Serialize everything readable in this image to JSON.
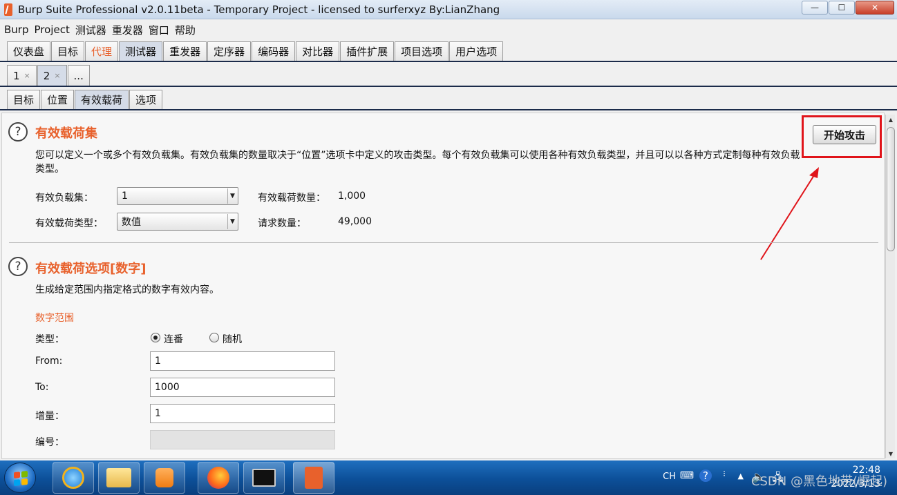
{
  "window": {
    "title": "Burp Suite Professional v2.0.11beta - Temporary Project - licensed to surferxyz By:LianZhang",
    "min": "—",
    "max": "☐",
    "close": "✕"
  },
  "menu": [
    "Burp",
    "Project",
    "测试器",
    "重发器",
    "窗口",
    "帮助"
  ],
  "main_tabs": [
    "仪表盘",
    "目标",
    "代理",
    "测试器",
    "重发器",
    "定序器",
    "编码器",
    "对比器",
    "插件扩展",
    "项目选项",
    "用户选项"
  ],
  "attack_tabs": [
    {
      "label": "1",
      "close": "×"
    },
    {
      "label": "2",
      "close": "×"
    },
    {
      "label": "..."
    }
  ],
  "sub_tabs": [
    "目标",
    "位置",
    "有效载荷",
    "选项"
  ],
  "payload_sets": {
    "help": "?",
    "title": "有效载荷集",
    "description": "您可以定义一个或多个有效负载集。有效负载集的数量取决于“位置”选项卡中定义的攻击类型。每个有效负载集可以使用各种有效负载类型，并且可以以各种方式定制每种有效负载类型。",
    "set_label": "有效负载集：",
    "set_value": "1",
    "type_label": "有效载荷类型：",
    "type_value": "数值",
    "count_label": "有效载荷数量：",
    "count_value": "1,000",
    "requests_label": "请求数量：",
    "requests_value": "49,000",
    "start_attack": "开始攻击"
  },
  "payload_options": {
    "help": "?",
    "title": "有效载荷选项[数字]",
    "description": "生成给定范围内指定格式的数字有效内容。",
    "range_heading": "数字范围",
    "type_label": "类型：",
    "radio_sequential": "连番",
    "radio_random": "随机",
    "from_label": "From:",
    "from_value": "1",
    "to_label": "To:",
    "to_value": "1000",
    "step_label": "增量：",
    "step_value": "1",
    "howmany_label": "编号：",
    "howmany_value": ""
  },
  "taskbar": {
    "tray_lang": "CH",
    "time": "22:48",
    "date": "2022/3/13",
    "watermark": "CSDN @黑色地带(崛起)"
  },
  "colors": {
    "accent_orange": "#e8612c",
    "annotation_red": "#e0141a",
    "taskbar_blue": "#0c4f98"
  }
}
